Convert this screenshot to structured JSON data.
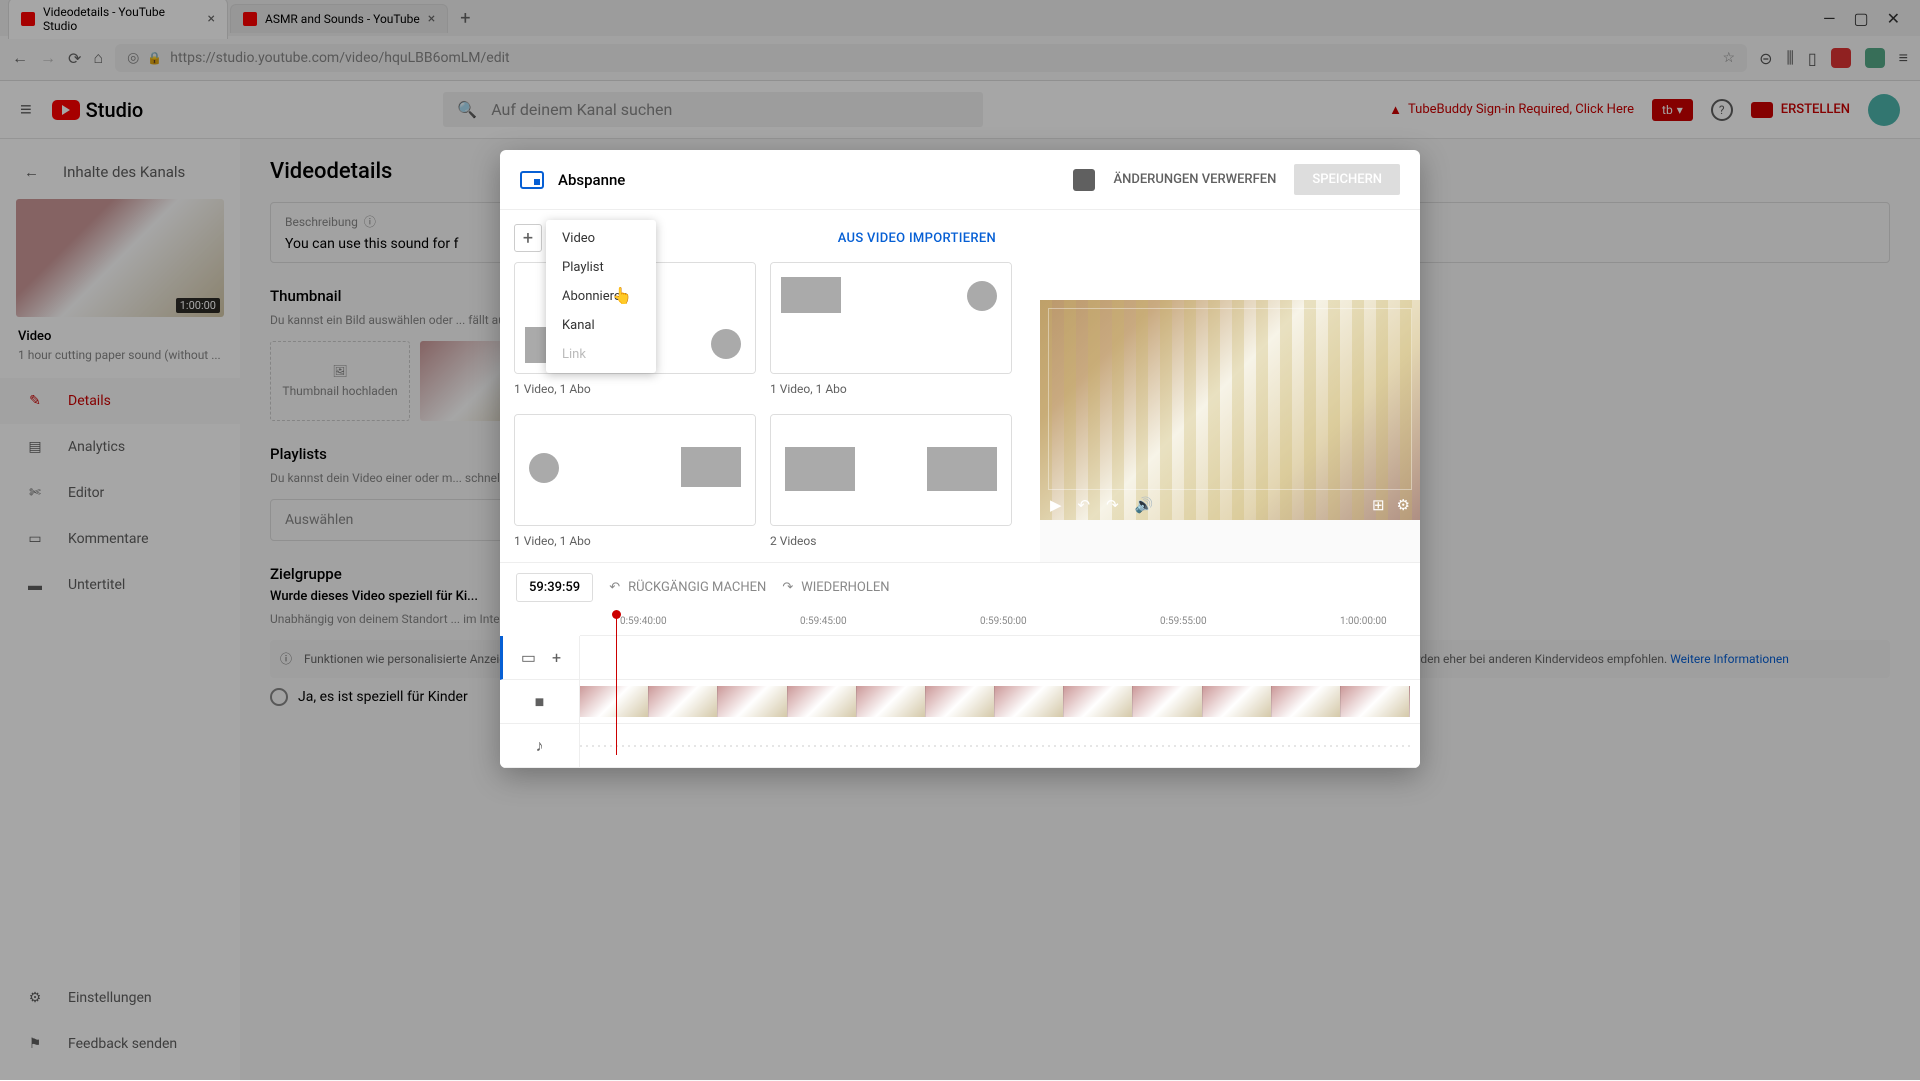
{
  "browser": {
    "tabs": [
      {
        "title": "Videodetails - YouTube Studio",
        "active": true
      },
      {
        "title": "ASMR and Sounds - YouTube",
        "active": false
      }
    ],
    "url": "https://studio.youtube.com/video/hquLBB6omLM/edit"
  },
  "header": {
    "logo": "Studio",
    "search_placeholder": "Auf deinem Kanal suchen",
    "tubebuddy_warning": "TubeBuddy Sign-in Required, Click Here",
    "tb_badge": "tb",
    "create": "ERSTELLEN"
  },
  "sidebar": {
    "back": "Inhalte des Kanals",
    "thumb_duration": "1:00:00",
    "video_label": "Video",
    "video_title": "1 hour cutting paper sound (without ...",
    "items": [
      {
        "label": "Details",
        "active": true
      },
      {
        "label": "Analytics"
      },
      {
        "label": "Editor"
      },
      {
        "label": "Kommentare"
      },
      {
        "label": "Untertitel"
      }
    ],
    "bottom": [
      {
        "label": "Einstellungen"
      },
      {
        "label": "Feedback senden"
      }
    ]
  },
  "content": {
    "title": "Videodetails",
    "desc_label": "Beschreibung",
    "desc_text": "You can use this sound for f",
    "thumbnail_title": "Thumbnail",
    "thumbnail_sub": "Du kannst ein Bild auswählen oder ... fällt auf und erzeugt Interesse bei ...",
    "thumbnail_upload": "Thumbnail hochladen",
    "playlists_title": "Playlists",
    "playlists_sub": "Du kannst dein Video einer oder m... schneller finden.",
    "more_info": "Weitere Informationen",
    "playlist_select": "Auswählen",
    "audience_title": "Zielgruppe",
    "audience_q": "Wurde dieses Video speziell für Ki...",
    "audience_sub": "Unabhängig von deinem Standort ... im Internet (Children's Online Priva... ob deine Videos sich an Kinder richte...",
    "audience_note": "Funktionen wie personalisierte Anzeigen und Benachrichtigungen sind bei Videos, die als \"speziell für Kinder\" gekennzeichnet werden, nicht verfügbar. Videos, die als \"speziell für Kinder\" gekennzeichnet sind, werden eher bei anderen Kindervideos empfohlen.",
    "radio1": "Ja, es ist speziell für Kinder"
  },
  "modal": {
    "title": "Abspanne",
    "discard": "ÄNDERUNGEN VERWERFEN",
    "save": "SPEICHERN",
    "import": "AUS VIDEO IMPORTIEREN",
    "dropdown": {
      "video": "Video",
      "playlist": "Playlist",
      "subscribe": "Abonnieren",
      "channel": "Kanal",
      "link": "Link"
    },
    "templates": [
      {
        "label": "1 Video, 1 Abo"
      },
      {
        "label": "1 Video, 1 Abo"
      },
      {
        "label": "1 Video, 1 Abo"
      },
      {
        "label": "2 Videos"
      }
    ],
    "timeline": {
      "time": "59:39:59",
      "undo": "RÜCKGÄNGIG MACHEN",
      "redo": "WIEDERHOLEN",
      "ticks": [
        "0:59:40:00",
        "0:59:45:00",
        "0:59:50:00",
        "0:59:55:00",
        "1:00:00:00"
      ]
    }
  }
}
